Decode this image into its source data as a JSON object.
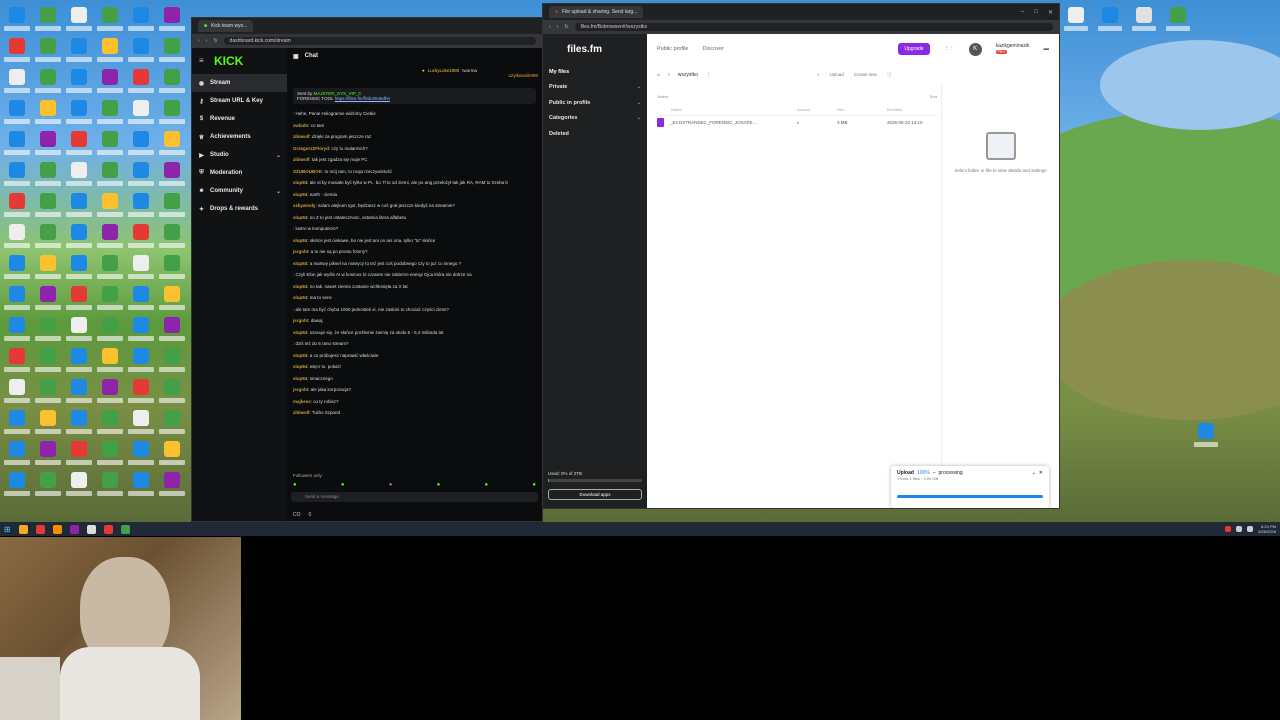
{
  "kick": {
    "tab_title": "Kick team wyo...",
    "url": "dashboard.kick.com/stream",
    "logo": "KICK",
    "sidebar": [
      {
        "label": "Stream",
        "icon": "broadcast-icon"
      },
      {
        "label": "Stream URL & Key",
        "icon": "key-icon"
      },
      {
        "label": "Revenue",
        "icon": "dollar-icon"
      },
      {
        "label": "Achievements",
        "icon": "trophy-icon"
      },
      {
        "label": "Studio",
        "icon": "studio-icon"
      },
      {
        "label": "Moderation",
        "icon": "shield-icon"
      },
      {
        "label": "Community",
        "icon": "users-icon"
      },
      {
        "label": "Drops & rewards",
        "icon": "gift-icon"
      }
    ],
    "chat_title": "Chat",
    "top_users": [
      "LuckyLuke1980",
      "tworma",
      "uzytkownik090"
    ],
    "pinned_by": "Sent by",
    "pinned_user": "MAJSTER_SYS_VIP_C",
    "pinned_text": "FORENSIC TOOL",
    "pinned_link": "https://files.fm/f/afo2846dhn",
    "messages": [
      {
        "user": "",
        "text": "Hehe, Panie Hologramie widzimy Ciebie"
      },
      {
        "user": "zwlodn",
        "text": "co tam"
      },
      {
        "user": "zibiwolf",
        "text": "dzięki za program jeszcze raz"
      },
      {
        "user": "GrzegorzZFloryd",
        "text": "czy to malarmich?"
      },
      {
        "user": "zibiwolf",
        "text": "tak jest zgadza się moje PC"
      },
      {
        "user": "SZUBOUBOK",
        "text": "to mój ram, to moja rzeczywistość"
      },
      {
        "user": "slup84",
        "text": "ale ot by musiało być tylko w Pi., bo 7l to od ziemi, ale po ang przełożył tak jak RA, RAM to trzeba b"
      },
      {
        "user": "slup84",
        "text": "earth - ziemia"
      },
      {
        "user": "szkywindy",
        "text": "salam alejkum Igor, będziesz w coś grał jeszcze kiedyś na streamie?"
      },
      {
        "user": "slup84",
        "text": "no Z to jest ostatecznosc, ostatnia litera alfabetu"
      },
      {
        "user": "",
        "text": "lustro w komputerze?"
      },
      {
        "user": "slup84",
        "text": "słońce jest ciekawe, bo nie jest ani on ani ona, tylko \"to\" słońce"
      },
      {
        "user": "jsrgoht",
        "text": "a to nie są po prostu fotony?"
      },
      {
        "user": "slup84",
        "text": "a martwy piksel na matrycy to też jest coś podobnego czy to już co innego ?"
      },
      {
        "user": "",
        "text": "Czyli Elon jak wyśle AI w kosmos to czasem nie zabierze energi Ojca która nie dotrze na"
      },
      {
        "user": "slup84",
        "text": "no tak, nawet ziemia zostanie wchłonięta za X lat"
      },
      {
        "user": "slup84",
        "text": "ma to sens"
      },
      {
        "user": "",
        "text": "ale tam ma być chyba 1000 jednostek xi, nie zasłoni to chociaż części ziemi?"
      },
      {
        "user": "jsrgoht",
        "text": "dawaj"
      },
      {
        "user": "slup84",
        "text": "szacuje się, że słońce pochłonie ziemię za około 5 - 5,4 miliarda lat"
      },
      {
        "user": "",
        "text": "dziś też do 6 rano stream?"
      },
      {
        "user": "slup84",
        "text": "a co próbujesz naprawić właściwie"
      },
      {
        "user": "slup84",
        "text": "więcr to, pokaż!"
      },
      {
        "user": "slup84",
        "text": "smacznego"
      },
      {
        "user": "jsrgoht",
        "text": "ale jaka korporacja?"
      },
      {
        "user": "majkess",
        "text": "co ty robisz?"
      },
      {
        "user": "zibiwolf",
        "text": "Turbo Szpond"
      }
    ],
    "followers_only": "Followers only",
    "input_placeholder": "Send a message",
    "viewers": "CO",
    "footer_count": "0"
  },
  "files": {
    "tab_title": "File upload & sharing. Send larg...",
    "url": "files.fm/Bobrowsen#/wszystko",
    "logo": "files.fm",
    "top_links": [
      "Public profile",
      "Discover"
    ],
    "upgrade": "Upgrade",
    "account": "kazikgeminazik",
    "account_badge": "PRO",
    "sidebar": [
      "My files",
      "Private",
      "Public in profile",
      "Categories",
      "Deleted"
    ],
    "folder": "wszystko",
    "tools": [
      "Upload",
      "Create new"
    ],
    "select": "Select",
    "sort": "Sort",
    "columns": [
      "Name",
      "Access",
      "Size",
      "Modified"
    ],
    "file_row": {
      "name": "_ECOSTRANSEC_FORENSIC_JOSAFE....",
      "size": "3 MB",
      "date": "2026-05-22 13:10"
    },
    "details_hint": "Select folder or file to view details and settings",
    "used": "Used: 0% of 2TB",
    "used_fraction": 0.01,
    "download_app": "Download apps",
    "upload_title": "Upload",
    "upload_pct": "100%",
    "upload_status": "processing",
    "upload_sub": "1 from 1 files",
    "upload_size": "2.00 GB",
    "upload_fraction": 1.0
  },
  "clock": {
    "time": "6:24 PM",
    "date": "5/26/2026"
  }
}
